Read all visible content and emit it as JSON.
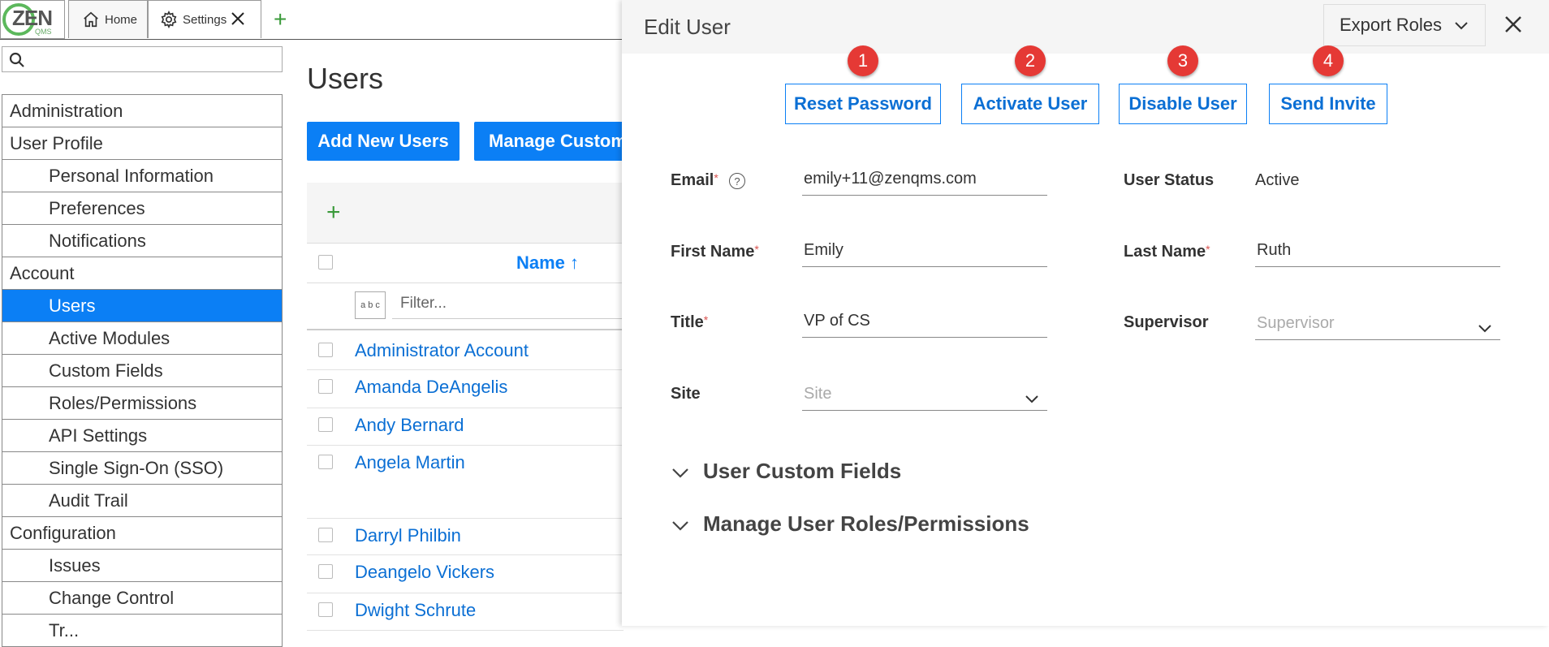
{
  "tabs": {
    "logo_text": "ZEN",
    "logo_sub": "QMS",
    "home": "Home",
    "settings": "Settings",
    "add": "+"
  },
  "sidebar": {
    "items": [
      {
        "label": "Administration",
        "level": 0
      },
      {
        "label": "User Profile",
        "level": 0
      },
      {
        "label": "Personal Information",
        "level": 1
      },
      {
        "label": "Preferences",
        "level": 1
      },
      {
        "label": "Notifications",
        "level": 1
      },
      {
        "label": "Account",
        "level": 0
      },
      {
        "label": "Users",
        "level": 1,
        "active": true
      },
      {
        "label": "Active Modules",
        "level": 1
      },
      {
        "label": "Custom Fields",
        "level": 1
      },
      {
        "label": "Roles/Permissions",
        "level": 1
      },
      {
        "label": "API Settings",
        "level": 1
      },
      {
        "label": "Single Sign-On (SSO)",
        "level": 1
      },
      {
        "label": "Audit Trail",
        "level": 1
      },
      {
        "label": "Configuration",
        "level": 0
      },
      {
        "label": "Issues",
        "level": 1
      },
      {
        "label": "Change Control",
        "level": 1
      },
      {
        "label": "Tr...",
        "level": 1
      }
    ]
  },
  "main": {
    "title": "Users",
    "add_users": "Add New Users",
    "manage_custom": "Manage Custom",
    "grid": {
      "add": "+",
      "name_header": "Name ↑",
      "filter_placeholder": "Filter...",
      "abc": "a b c",
      "rows": [
        "Administrator Account",
        "Amanda DeAngelis",
        "Andy Bernard",
        "Angela Martin",
        "Darryl Philbin",
        "Deangelo Vickers",
        "Dwight Schrute"
      ]
    }
  },
  "panel": {
    "title": "Edit User",
    "export_roles": "Export Roles",
    "actions": [
      {
        "label": "Reset Password",
        "badge": "1"
      },
      {
        "label": "Activate User",
        "badge": "2"
      },
      {
        "label": "Disable User",
        "badge": "3"
      },
      {
        "label": "Send Invite",
        "badge": "4"
      }
    ],
    "fields": {
      "email_label": "Email",
      "email_value": "emily+11@zenqms.com",
      "user_status_label": "User Status",
      "user_status_value": "Active",
      "first_name_label": "First Name",
      "first_name_value": "Emily",
      "last_name_label": "Last Name",
      "last_name_value": "Ruth",
      "title_label": "Title",
      "title_value": "VP of CS",
      "supervisor_label": "Supervisor",
      "supervisor_placeholder": "Supervisor",
      "site_label": "Site",
      "site_placeholder": "Site",
      "required_mark": "*",
      "help": "?"
    },
    "sections": {
      "custom_fields": "User Custom Fields",
      "roles": "Manage User Roles/Permissions"
    }
  },
  "colors": {
    "accent": "#0b7ff5",
    "badge": "#e53935",
    "green": "#3a9a3a"
  }
}
